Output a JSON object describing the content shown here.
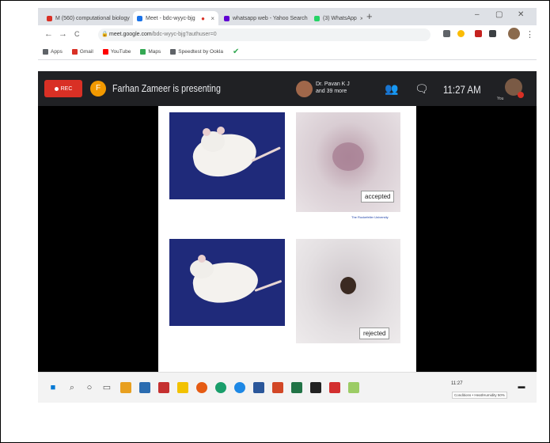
{
  "browser": {
    "tabs": [
      {
        "label": "M (560) computational biology",
        "favicon_color": "#d93025",
        "active": false
      },
      {
        "label": "Meet - bdc-wyyc-bjg",
        "favicon_color": "#1a73e8",
        "active": true
      },
      {
        "label": "whatsapp web - Yahoo Search",
        "favicon_color": "#6001d2",
        "active": false
      },
      {
        "label": "(3) WhatsApp",
        "favicon_color": "#25d366",
        "active": false
      }
    ],
    "new_tab_glyph": "+",
    "window_controls": {
      "minimize": "–",
      "maximize": "▢",
      "close": "✕"
    },
    "nav": {
      "back": "←",
      "forward": "→",
      "reload": "C"
    },
    "url_host": "meet.google.com",
    "url_path": "/bdc-wyyc-bjg?authuser=0",
    "bookmarks": [
      {
        "label": "Apps",
        "color": "#5f6368"
      },
      {
        "label": "Gmail",
        "color": "#d93025"
      },
      {
        "label": "YouTube",
        "color": "#ff0000"
      },
      {
        "label": "Maps",
        "color": "#34a853"
      },
      {
        "label": "Speedtest by Ookla",
        "color": "#5f6368"
      }
    ]
  },
  "meet": {
    "rec_label": "REC",
    "presenter_initial": "F",
    "presenter_text": "Farhan Zameer is presenting",
    "participants_line1": "Dr. Pavan K J",
    "participants_line2": "and 39 more",
    "clock": "11:27 AM",
    "self_label": "You"
  },
  "slide": {
    "caption_accepted": "accepted",
    "caption_rejected": "rejected",
    "credit": "The Rockefeller University"
  },
  "taskbar": {
    "tray_time": "11:27",
    "toast_text": "Conditions • Heat/Humidity 50%"
  },
  "colors": {
    "meet_bar": "#202124",
    "rec": "#d93025",
    "presenter_avatar": "#f29900",
    "slide_photo_bg": "#1f2a7a"
  }
}
